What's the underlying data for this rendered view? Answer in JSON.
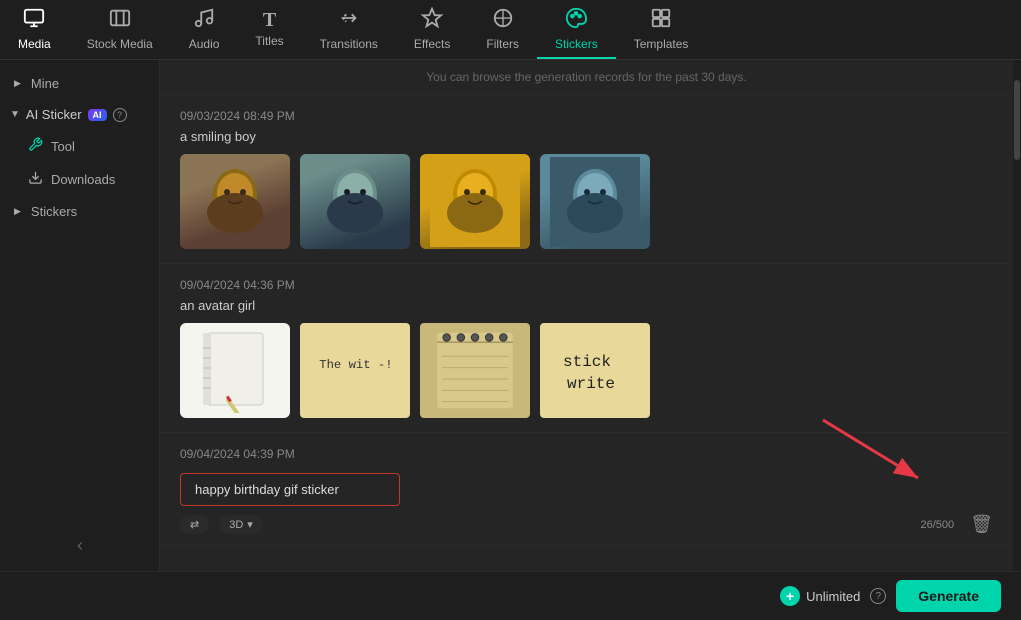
{
  "nav": {
    "items": [
      {
        "id": "media",
        "icon": "⬛",
        "label": "Media",
        "active": false
      },
      {
        "id": "stock-media",
        "icon": "🎬",
        "label": "Stock Media",
        "active": false
      },
      {
        "id": "audio",
        "icon": "🎵",
        "label": "Audio",
        "active": false
      },
      {
        "id": "titles",
        "icon": "T",
        "label": "Titles",
        "active": false
      },
      {
        "id": "transitions",
        "icon": "▶",
        "label": "Transitions",
        "active": false
      },
      {
        "id": "effects",
        "icon": "✦",
        "label": "Effects",
        "active": false
      },
      {
        "id": "filters",
        "icon": "⬡",
        "label": "Filters",
        "active": false
      },
      {
        "id": "stickers",
        "icon": "✿",
        "label": "Stickers",
        "active": true
      },
      {
        "id": "templates",
        "icon": "⊞",
        "label": "Templates",
        "active": false
      }
    ]
  },
  "sidebar": {
    "mine_label": "Mine",
    "ai_sticker_label": "AI Sticker",
    "tool_label": "Tool",
    "downloads_label": "Downloads",
    "stickers_label": "Stickers",
    "collapse_label": "Collapse"
  },
  "content": {
    "browse_notice": "You can browse the generation records for the past 30 days.",
    "sections": [
      {
        "id": "section1",
        "date": "09/03/2024 08:49 PM",
        "label": "a smiling boy",
        "images": [
          "boy1",
          "boy2",
          "boy3",
          "boy4"
        ]
      },
      {
        "id": "section2",
        "date": "09/04/2024 04:36 PM",
        "label": "an avatar girl",
        "images": [
          "sticker-notebook",
          "sticker-note",
          "sticker-spiral",
          "sticker-write"
        ]
      }
    ],
    "generation": {
      "date": "09/04/2024 04:39 PM",
      "prompt": "happy birthday gif sticker",
      "char_count": "26/500",
      "options": [
        {
          "label": "3D",
          "icon": "⇄"
        },
        {
          "label": ""
        }
      ]
    }
  },
  "bottom_bar": {
    "unlimited_label": "Unlimited",
    "generate_label": "Generate",
    "plus_icon": "+",
    "question_mark": "?"
  }
}
